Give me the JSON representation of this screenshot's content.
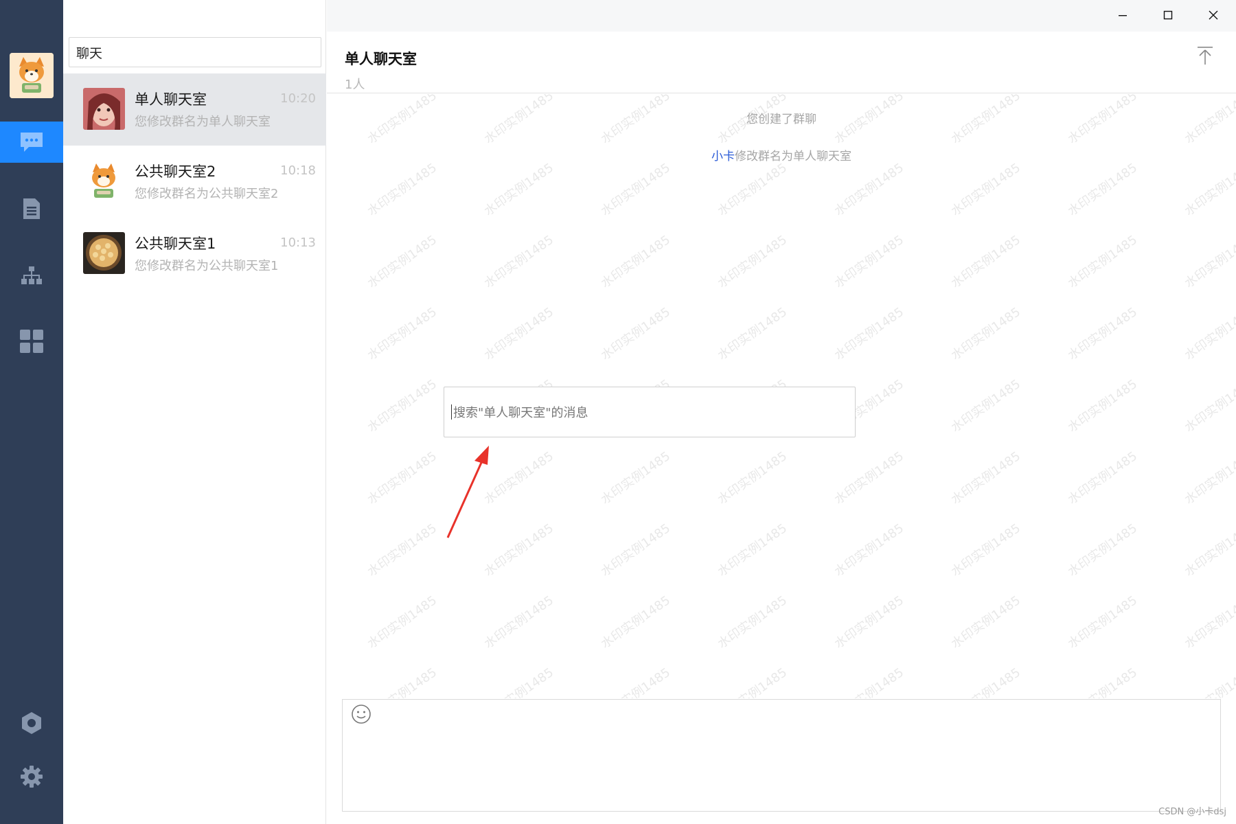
{
  "window": {
    "minimize_icon": "minimize-icon",
    "maximize_icon": "maximize-icon",
    "close_icon": "close-icon"
  },
  "rail": {
    "items": [
      {
        "icon": "chat-bubble-icon",
        "active": true
      },
      {
        "icon": "document-icon",
        "active": false
      },
      {
        "icon": "org-chart-icon",
        "active": false
      },
      {
        "icon": "apps-grid-icon",
        "active": false
      },
      {
        "icon": "record-icon",
        "active": false
      },
      {
        "icon": "settings-gear-icon",
        "active": false
      }
    ],
    "accent": "#1e88ff",
    "background": "#2f3e57"
  },
  "conversation_list": {
    "search_value": "聊天",
    "items": [
      {
        "name": "单人聊天室",
        "time": "10:20",
        "preview": "您修改群名为单人聊天室",
        "avatar": "portrait-avatar"
      },
      {
        "name": "公共聊天室2",
        "time": "10:18",
        "preview": "您修改群名为公共聊天室2",
        "avatar": "shiba-avatar"
      },
      {
        "name": "公共聊天室1",
        "time": "10:13",
        "preview": "您修改群名为公共聊天室1",
        "avatar": "food-avatar"
      }
    ]
  },
  "chat": {
    "title": "单人聊天室",
    "members": "1人",
    "system_messages": {
      "created": "您创建了群聊",
      "renamed_who": "小卡",
      "renamed_rest": "修改群名为单人聊天室"
    },
    "message_search_placeholder": "搜索\"单人聊天室\"的消息",
    "watermark": "水印实例1485",
    "emoji_icon": "smiley-icon",
    "scroll_top_icon": "scroll-to-top-icon"
  },
  "credit": "CSDN @小卡dsj"
}
